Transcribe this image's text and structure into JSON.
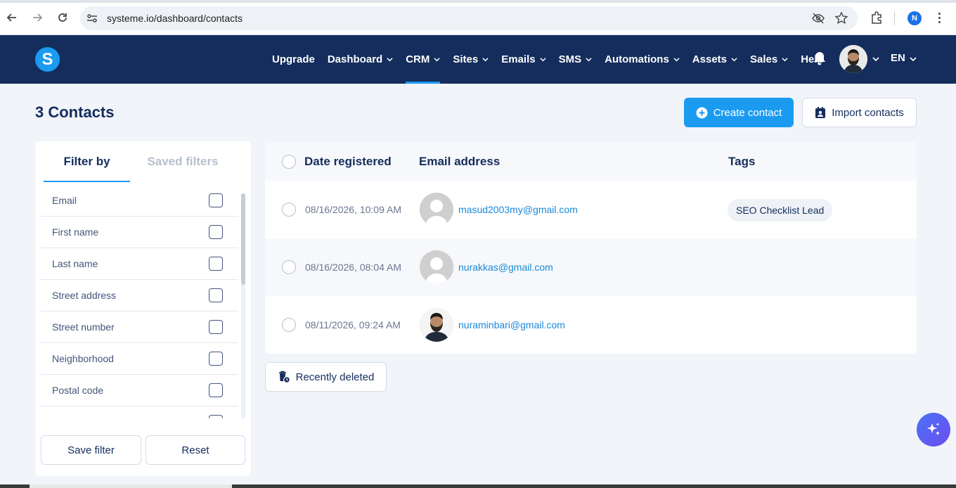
{
  "browser": {
    "url": "systeme.io/dashboard/contacts",
    "profile_initial": "N"
  },
  "nav": {
    "items": [
      {
        "label": "Upgrade",
        "dropdown": false
      },
      {
        "label": "Dashboard",
        "dropdown": true
      },
      {
        "label": "CRM",
        "dropdown": true,
        "active": true
      },
      {
        "label": "Sites",
        "dropdown": true
      },
      {
        "label": "Emails",
        "dropdown": true
      },
      {
        "label": "SMS",
        "dropdown": true
      },
      {
        "label": "Automations",
        "dropdown": true
      },
      {
        "label": "Assets",
        "dropdown": true
      },
      {
        "label": "Sales",
        "dropdown": true
      },
      {
        "label": "Help",
        "dropdown": false
      }
    ],
    "language": "EN"
  },
  "page": {
    "title": "3 Contacts",
    "create_button": "Create contact",
    "import_button": "Import contacts",
    "recently_deleted": "Recently deleted"
  },
  "filters": {
    "tabs": [
      "Filter by",
      "Saved filters"
    ],
    "fields": [
      "Email",
      "First name",
      "Last name",
      "Street address",
      "Street number",
      "Neighborhood",
      "Postal code"
    ],
    "save_button": "Save filter",
    "reset_button": "Reset"
  },
  "table": {
    "headers": {
      "date": "Date registered",
      "email": "Email address",
      "tags": "Tags"
    },
    "rows": [
      {
        "date": "08/16/2026, 10:09 AM",
        "email": "masud2003my@gmail.com",
        "tag": "SEO Checklist Lead",
        "avatar": "default"
      },
      {
        "date": "08/16/2026, 08:04 AM",
        "email": "nurakkas@gmail.com",
        "tag": "",
        "avatar": "default"
      },
      {
        "date": "08/11/2026, 09:24 AM",
        "email": "nuraminbari@gmail.com",
        "tag": "",
        "avatar": "photo"
      }
    ]
  },
  "colors": {
    "header_bg": "#142d5c",
    "accent": "#1a9bf0",
    "page_bg": "#f1f4f9",
    "link": "#1a88d8"
  }
}
